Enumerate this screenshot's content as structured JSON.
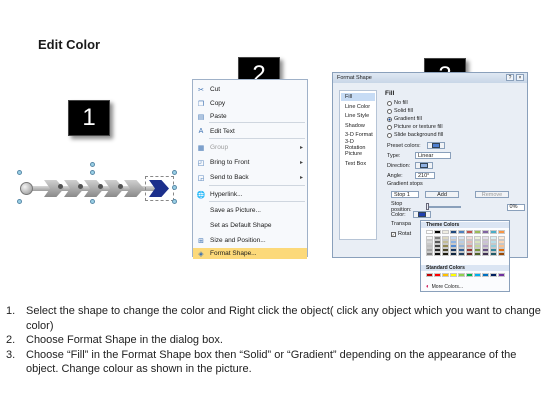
{
  "title": "Edit Color",
  "badges": [
    "1",
    "2",
    "3"
  ],
  "context_menu": {
    "items": [
      {
        "label": "Cut",
        "icon": "scissors-icon",
        "glyph": "✂",
        "u": "t"
      },
      {
        "label": "Copy",
        "icon": "copy-icon",
        "glyph": "❐",
        "u": "C"
      },
      {
        "label": "Paste",
        "icon": "paste-icon",
        "glyph": "▤",
        "u": "P"
      },
      {
        "label": "Edit Text",
        "icon": "edit-text-icon",
        "glyph": "A"
      },
      {
        "label": "Group",
        "icon": "group-icon",
        "glyph": "▦",
        "disabled": true,
        "submenu": true
      },
      {
        "label": "Bring to Front",
        "icon": "bring-front-icon",
        "glyph": "◰",
        "submenu": true
      },
      {
        "label": "Send to Back",
        "icon": "send-back-icon",
        "glyph": "◲",
        "submenu": true
      },
      {
        "label": "Hyperlink...",
        "icon": "hyperlink-icon",
        "glyph": "🌐"
      },
      {
        "label": "Save as Picture...",
        "icon": "",
        "glyph": ""
      },
      {
        "label": "Set as Default Shape",
        "icon": "",
        "glyph": ""
      },
      {
        "label": "Size and Position...",
        "icon": "size-position-icon",
        "glyph": "⊞"
      },
      {
        "label": "Format Shape...",
        "icon": "format-shape-icon",
        "glyph": "◈",
        "highlighted": true
      }
    ]
  },
  "dialog": {
    "title": "Format Shape",
    "title_buttons": [
      "?",
      "×"
    ],
    "nav": [
      "Fill",
      "Line Color",
      "Line Style",
      "Shadow",
      "3-D Format",
      "3-D Rotation",
      "Picture",
      "Text Box"
    ],
    "section": "Fill",
    "fill_options": [
      {
        "label": "No fill",
        "checked": false
      },
      {
        "label": "Solid fill",
        "checked": false
      },
      {
        "label": "Gradient fill",
        "checked": true
      },
      {
        "label": "Picture or texture fill",
        "checked": false
      },
      {
        "label": "Slide background fill",
        "checked": false
      }
    ],
    "preset_colors_label": "Preset colors:",
    "type_label": "Type:",
    "type_value": "Linear",
    "direction_label": "Direction:",
    "angle_label": "Angle:",
    "angle_value": "210°",
    "gradient_stops_label": "Gradient stops",
    "stop_value": "Stop 1",
    "add_label": "Add",
    "remove_label": "Remove",
    "stop_position_label": "Stop position:",
    "stop_position_value": "0%",
    "color_label": "Color:",
    "transparency_label": "Transpa",
    "rotate_label": "Rotat"
  },
  "palette": {
    "theme_label": "Theme Colors",
    "standard_label": "Standard Colors",
    "more_label": "More Colors...",
    "theme_top": [
      "#ffffff",
      "#000000",
      "#eeece1",
      "#1f497d",
      "#4f81bd",
      "#c0504d",
      "#9bbb59",
      "#8064a2",
      "#4bacc6",
      "#f79646"
    ],
    "theme_shades": [
      [
        "#f2f2f2",
        "#7f7f7f",
        "#ddd9c3",
        "#c6d9f0",
        "#dbe5f1",
        "#f2dcdb",
        "#ebf1dd",
        "#e5e0ec",
        "#dbeef3",
        "#fdeada"
      ],
      [
        "#d8d8d8",
        "#595959",
        "#c4bd97",
        "#8db3e2",
        "#b8cce4",
        "#e5b9b7",
        "#d7e3bc",
        "#ccc1d9",
        "#b7dde8",
        "#fbd5b5"
      ],
      [
        "#bfbfbf",
        "#3f3f3f",
        "#938953",
        "#548dd4",
        "#95b3d7",
        "#d99694",
        "#c3d69b",
        "#b2a2c7",
        "#92cddc",
        "#fac08f"
      ],
      [
        "#a5a5a5",
        "#262626",
        "#494429",
        "#17365d",
        "#366092",
        "#953734",
        "#76923c",
        "#5f497a",
        "#31859b",
        "#e36c09"
      ],
      [
        "#7f7f7f",
        "#0c0c0c",
        "#1d1b10",
        "#0f243e",
        "#244061",
        "#632423",
        "#4f6128",
        "#3f3151",
        "#205867",
        "#974806"
      ]
    ],
    "standard": [
      "#c00000",
      "#ff0000",
      "#ffc000",
      "#ffff00",
      "#92d050",
      "#00b050",
      "#00b0f0",
      "#0070c0",
      "#002060",
      "#7030a0"
    ]
  },
  "steps": [
    {
      "num": "1.",
      "text": "Select the shape to change the color and Right click the object( click any object which you want to change color)"
    },
    {
      "num": "2.",
      "text": "Choose Format Shape in the dialog box."
    },
    {
      "num": "3.",
      "text": "Choose “Fill” in the Format Shape box then “Solid” or “Gradient” depending on the appearance of the object. Change colour as shown in the picture."
    }
  ]
}
